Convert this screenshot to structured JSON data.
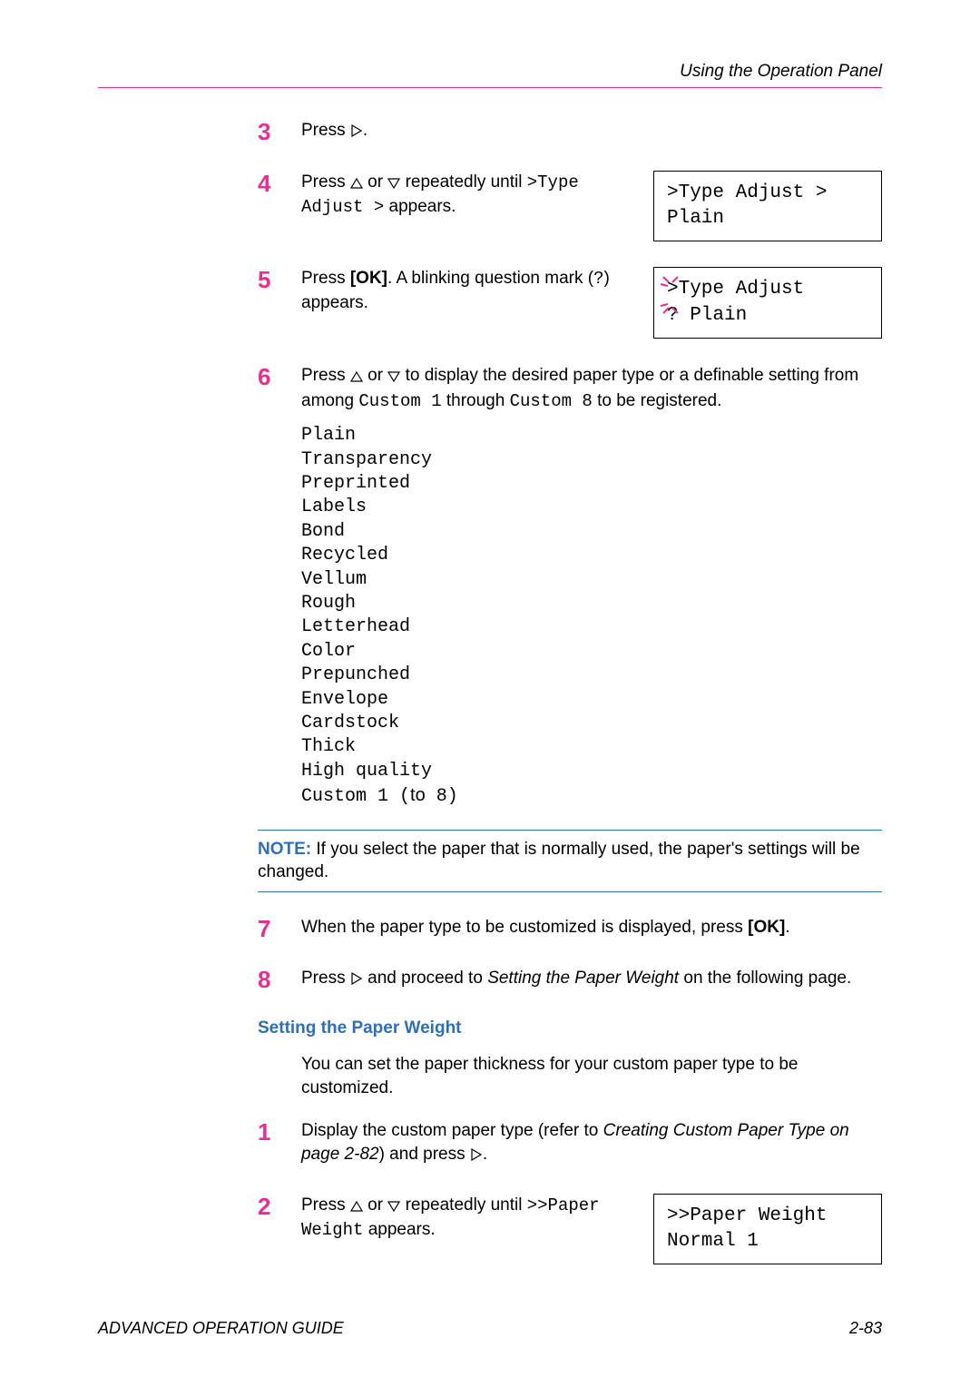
{
  "header": {
    "title": "Using the Operation Panel"
  },
  "steps_a": [
    {
      "num": "3",
      "text_pre": "Press ",
      "text_post": "."
    },
    {
      "num": "4",
      "text_pre": "Press ",
      "text_mid": " or ",
      "text_after": " repeatedly until ",
      "code1": ">Type Adjust >",
      "text_after2": " appears.",
      "display": {
        "line1": ">Type Adjust   >",
        "line2": "  Plain"
      }
    },
    {
      "num": "5",
      "text_pre": "Press ",
      "ok": "[OK]",
      "text_after": ". A blinking question mark (",
      "q": "?",
      "text_after2": ") appears.",
      "display": {
        "line1": ">Type Adjust",
        "line2": "? Plain"
      }
    },
    {
      "num": "6",
      "text_pre": "Press ",
      "text_mid": " or ",
      "text_after": " to display the desired paper type or a definable setting from among ",
      "code1": "Custom 1",
      "text_after2": " through ",
      "code2": "Custom 8",
      "text_after3": " to be registered."
    }
  ],
  "paper_types": [
    "Plain",
    "Transparency",
    "Preprinted",
    "Labels",
    "Bond",
    "Recycled",
    "Vellum",
    "Rough",
    "Letterhead",
    "Color",
    "Prepunched",
    "Envelope",
    "Cardstock",
    "Thick",
    "High quality"
  ],
  "paper_custom_pre": "Custom 1 (",
  "paper_custom_to": "to",
  "paper_custom_post": " 8)",
  "note": {
    "label": "NOTE:",
    "text": " If you select the paper that is normally used, the paper's settings will be changed."
  },
  "steps_b": [
    {
      "num": "7",
      "text_pre": "When the paper type to be customized is displayed, press ",
      "ok": "[OK]",
      "text_post": "."
    },
    {
      "num": "8",
      "text_pre": "Press ",
      "text_mid": " and proceed to ",
      "em": "Setting the Paper Weight",
      "text_post": " on the following page."
    }
  ],
  "subheading": "Setting the Paper Weight",
  "subtext": "You can set the paper thickness for your custom paper type to be customized.",
  "steps_c": [
    {
      "num": "1",
      "text_pre": "Display the custom paper type (refer to ",
      "em": "Creating Custom Paper Type on page 2-82",
      "text_mid": ") and press ",
      "text_post": "."
    },
    {
      "num": "2",
      "text_pre": "Press ",
      "text_mid": " or ",
      "text_after": " repeatedly until ",
      "code1": ">>Paper Weight",
      "text_after2": " appears.",
      "display": {
        "line1": ">>Paper Weight",
        "line2": "  Normal 1"
      }
    }
  ],
  "footer": {
    "left": "ADVANCED OPERATION GUIDE",
    "right": "2-83"
  }
}
